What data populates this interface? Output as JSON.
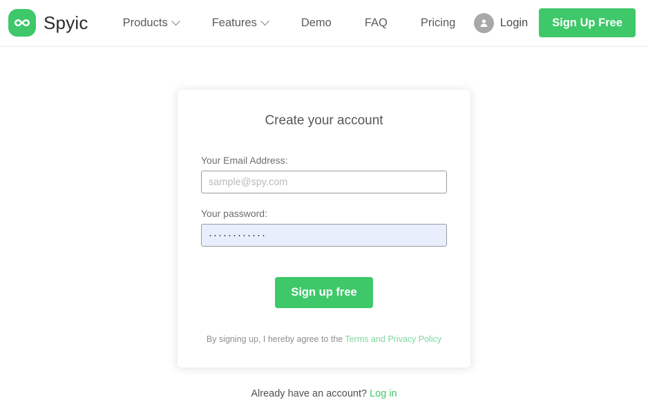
{
  "header": {
    "brand": {
      "name": "Spyic",
      "logo_icon": "infinity-logo-icon",
      "logo_color": "#3ec86a"
    },
    "nav": [
      {
        "label": "Products",
        "has_dropdown": true
      },
      {
        "label": "Features",
        "has_dropdown": true
      },
      {
        "label": "Demo",
        "has_dropdown": false
      },
      {
        "label": "FAQ",
        "has_dropdown": false
      },
      {
        "label": "Pricing",
        "has_dropdown": false
      }
    ],
    "login": {
      "label": "Login",
      "icon": "user-avatar-icon"
    },
    "signup_button": {
      "label": "Sign Up Free",
      "color": "#3ec86a"
    }
  },
  "signup_card": {
    "title": "Create your account",
    "email_field": {
      "label": "Your Email Address:",
      "placeholder": "sample@spy.com",
      "value": ""
    },
    "password_field": {
      "label": "Your password:",
      "placeholder": "",
      "value": "············",
      "autofilled": true,
      "autofill_color": "#e8eefc"
    },
    "submit_button": {
      "label": "Sign up free",
      "color": "#3ec86a"
    },
    "terms": {
      "prefix": "By signing up, I hereby agree to the ",
      "link_label": "Terms and Privacy Policy",
      "link_color": "#7ed6a0"
    }
  },
  "footer_prompt": {
    "text": "Already have an account? ",
    "link_label": "Log in",
    "link_color": "#3ec86a"
  }
}
